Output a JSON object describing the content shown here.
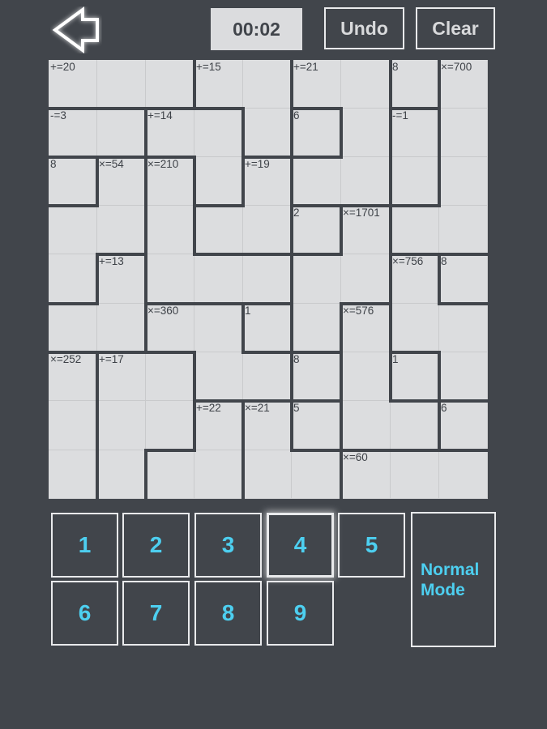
{
  "header": {
    "back_icon": "back-arrow-icon",
    "timer": "00:02",
    "undo_label": "Undo",
    "clear_label": "Clear"
  },
  "puzzle": {
    "size": 9,
    "cage_map": [
      [
        "A",
        "A",
        "A",
        "B",
        "B",
        "C",
        "C",
        "D",
        "E"
      ],
      [
        "F",
        "F",
        "G",
        "G",
        "B",
        "H",
        "C",
        "I",
        "E"
      ],
      [
        "J",
        "K",
        "L",
        "G",
        "M",
        "C",
        "C",
        "I",
        "E"
      ],
      [
        "K",
        "K",
        "L",
        "M",
        "M",
        "N",
        "O",
        "E",
        "E"
      ],
      [
        "K",
        "P",
        "L",
        "L",
        "L",
        "O",
        "O",
        "Q",
        "R"
      ],
      [
        "P",
        "P",
        "S",
        "S",
        "T",
        "O",
        "U",
        "Q",
        "Q"
      ],
      [
        "V",
        "W",
        "W",
        "S",
        "S",
        "X",
        "U",
        "Y",
        "Q"
      ],
      [
        "V",
        "W",
        "W",
        "Z",
        "AA",
        "AB",
        "U",
        "U",
        "AC"
      ],
      [
        "V",
        "W",
        "Z",
        "Z",
        "AA",
        "AA",
        "AD",
        "AD",
        "AD"
      ]
    ],
    "cages": {
      "A": {
        "clue": "+=20"
      },
      "B": {
        "clue": "+=15"
      },
      "C": {
        "clue": "+=21"
      },
      "D": {
        "clue": "8"
      },
      "E": {
        "clue": "×=700"
      },
      "F": {
        "clue": "-=3"
      },
      "G": {
        "clue": "+=14"
      },
      "H": {
        "clue": "6"
      },
      "I": {
        "clue": "-=1"
      },
      "J": {
        "clue": "8"
      },
      "K": {
        "clue": "×=54"
      },
      "L": {
        "clue": "×=210"
      },
      "M": {
        "clue": "+=19"
      },
      "N": {
        "clue": "2"
      },
      "O": {
        "clue": "×=1701"
      },
      "P": {
        "clue": "+=13"
      },
      "Q": {
        "clue": "×=756"
      },
      "R": {
        "clue": "8"
      },
      "S": {
        "clue": "×=360"
      },
      "T": {
        "clue": "1"
      },
      "U": {
        "clue": "×=576"
      },
      "V": {
        "clue": "×=252"
      },
      "W": {
        "clue": "+=17"
      },
      "X": {
        "clue": "8"
      },
      "Y": {
        "clue": "1"
      },
      "Z": {
        "clue": "+=22"
      },
      "AA": {
        "clue": "×=21"
      },
      "AB": {
        "clue": "5"
      },
      "AC": {
        "clue": "6"
      },
      "AD": {
        "clue": "×=60"
      }
    },
    "values": []
  },
  "keypad": {
    "keys": [
      "1",
      "2",
      "3",
      "4",
      "5",
      "6",
      "7",
      "8",
      "9"
    ],
    "selected": "4",
    "mode_line1": "Normal",
    "mode_line2": "Mode"
  },
  "colors": {
    "background": "#41454b",
    "cell": "#dcdddf",
    "accent": "#4dcff0"
  }
}
